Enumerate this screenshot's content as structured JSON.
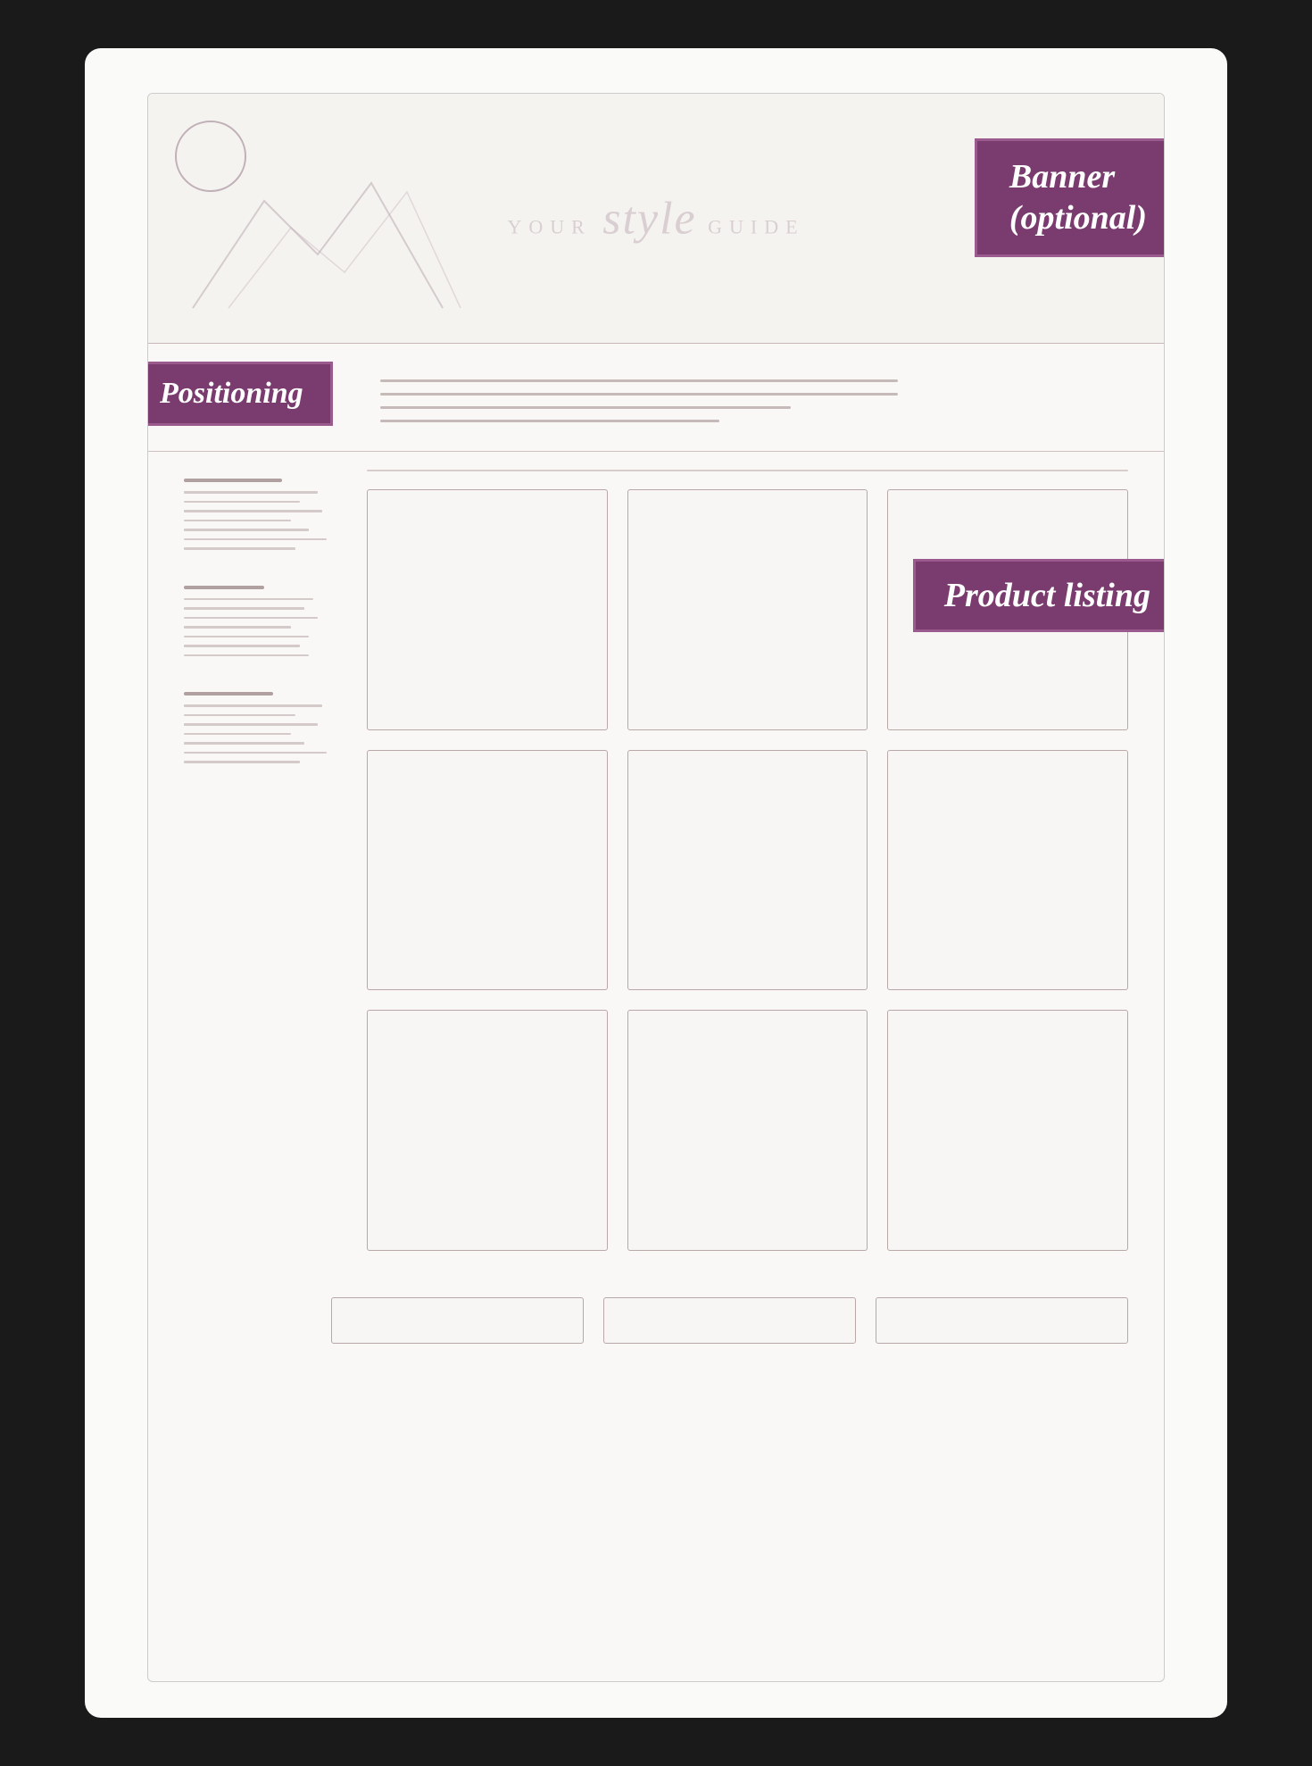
{
  "page": {
    "background": "#1a1a1a"
  },
  "banner": {
    "label_line1": "Banner",
    "label_line2": "(optional)"
  },
  "positioning": {
    "label": "Positioning"
  },
  "product_listing": {
    "label": "Product listing"
  },
  "style_guide": {
    "your": "YOUR",
    "style": "style",
    "guide": "GUIDE"
  }
}
